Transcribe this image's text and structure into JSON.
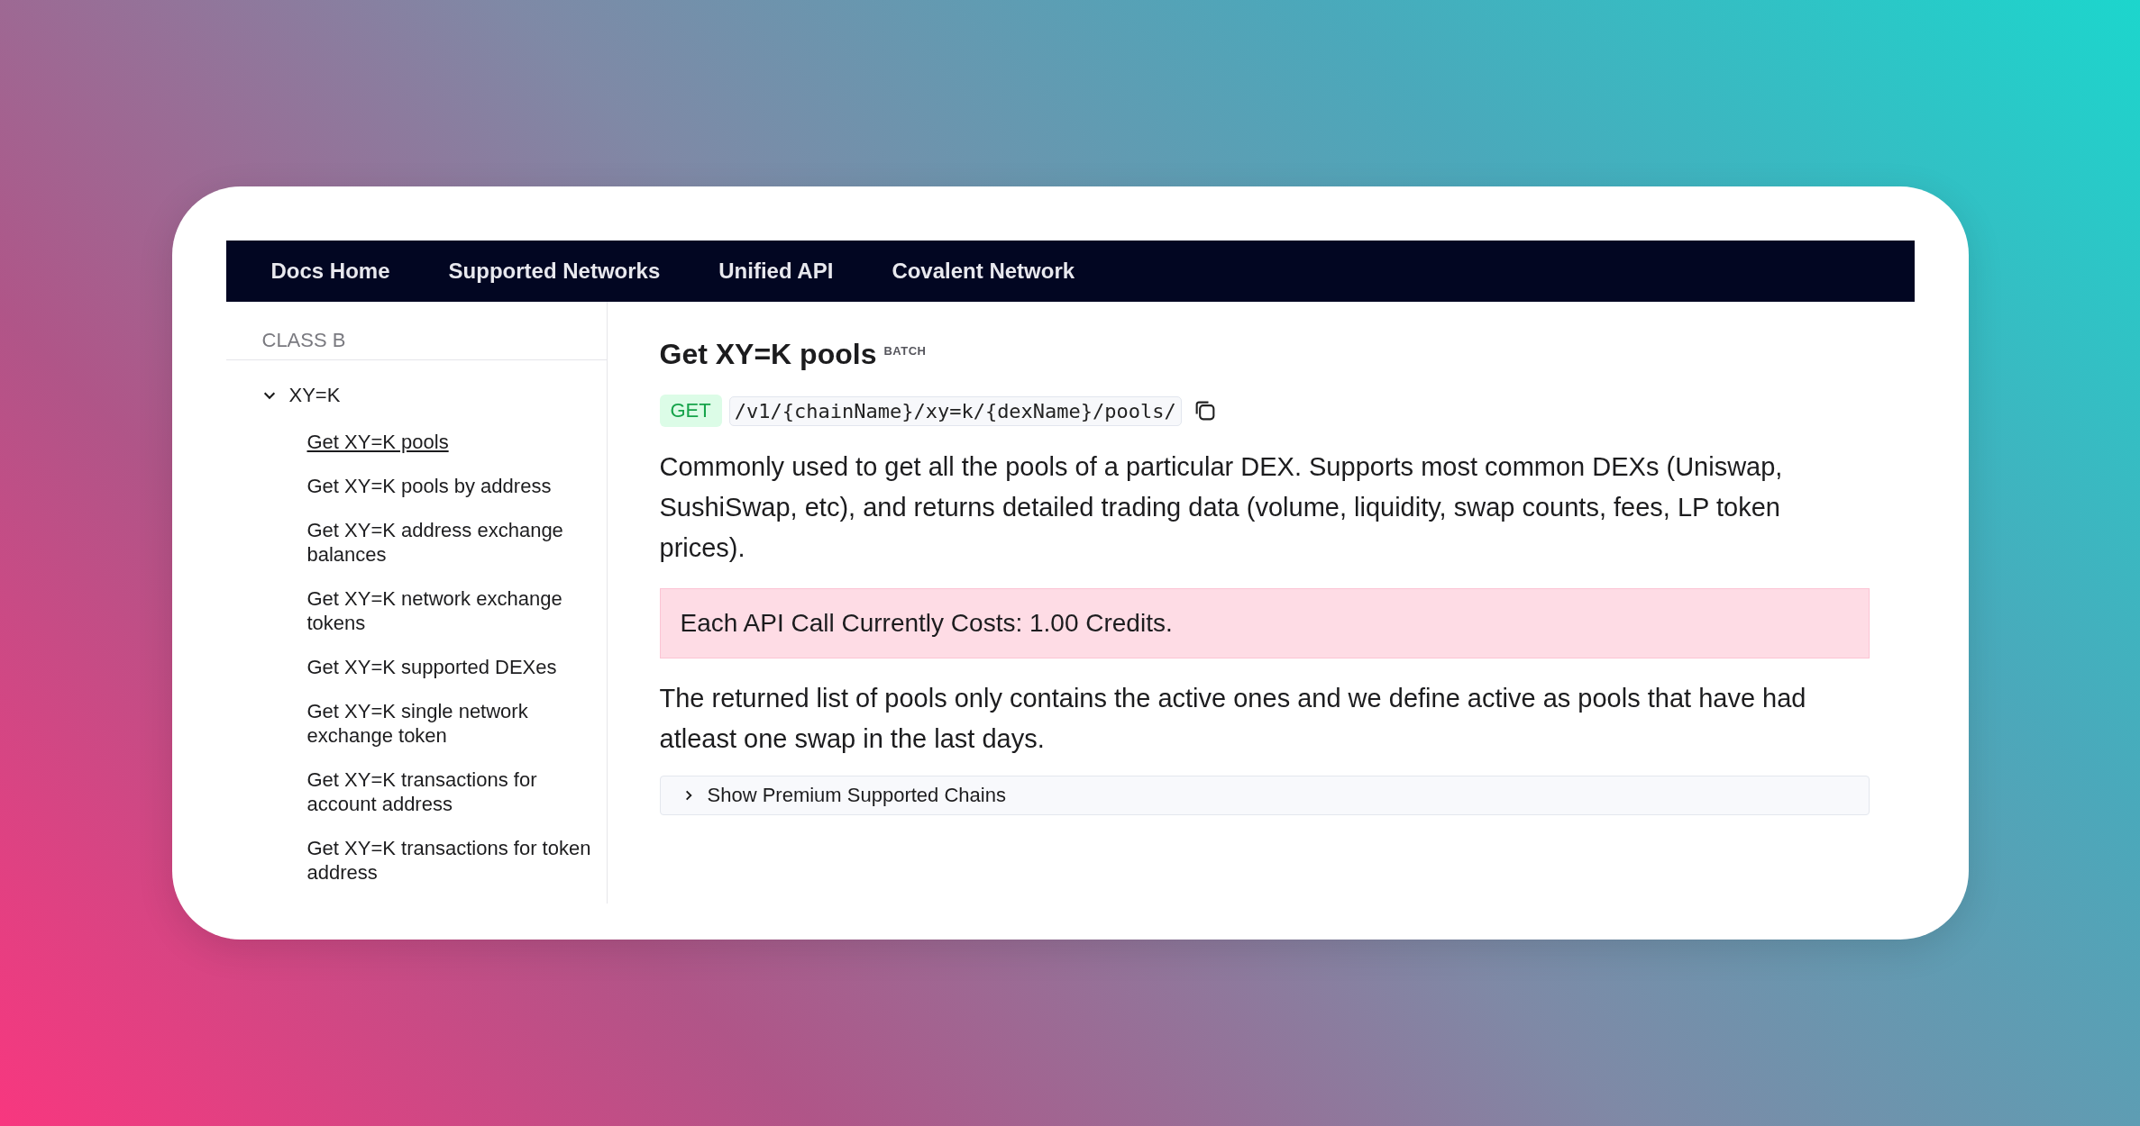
{
  "nav": {
    "items": [
      {
        "label": "Docs Home"
      },
      {
        "label": "Supported Networks"
      },
      {
        "label": "Unified API"
      },
      {
        "label": "Covalent Network"
      }
    ]
  },
  "sidebar": {
    "section_title": "CLASS B",
    "groups": [
      {
        "label": "XY=K",
        "expanded": true,
        "children": [
          {
            "label": "Get XY=K pools",
            "selected": true
          },
          {
            "label": "Get XY=K pools by address",
            "selected": false
          },
          {
            "label": "Get XY=K address exchange balances",
            "selected": false
          },
          {
            "label": "Get XY=K network exchange tokens",
            "selected": false
          },
          {
            "label": "Get XY=K supported DEXes",
            "selected": false
          },
          {
            "label": "Get XY=K single network exchange token",
            "selected": false
          },
          {
            "label": "Get XY=K transactions for account address",
            "selected": false
          },
          {
            "label": "Get XY=K transactions for token address",
            "selected": false
          }
        ]
      }
    ]
  },
  "content": {
    "title": "Get XY=K pools",
    "title_badge": "BATCH",
    "method": "GET",
    "endpoint": "/v1/{chainName}/xy=k/{dexName}/pools/",
    "description": "Commonly used to get all the pools of a particular DEX. Supports most common DEXs (Uniswap, SushiSwap, etc), and returns detailed trading data (volume, liquidity, swap counts, fees, LP token prices).",
    "callout": "Each API Call Currently Costs: 1.00 Credits.",
    "note": "The returned list of pools only contains the active ones and we define active as pools that have had atleast one swap in the last days.",
    "disclosure": {
      "label": "Show Premium Supported Chains",
      "expanded": false
    }
  }
}
